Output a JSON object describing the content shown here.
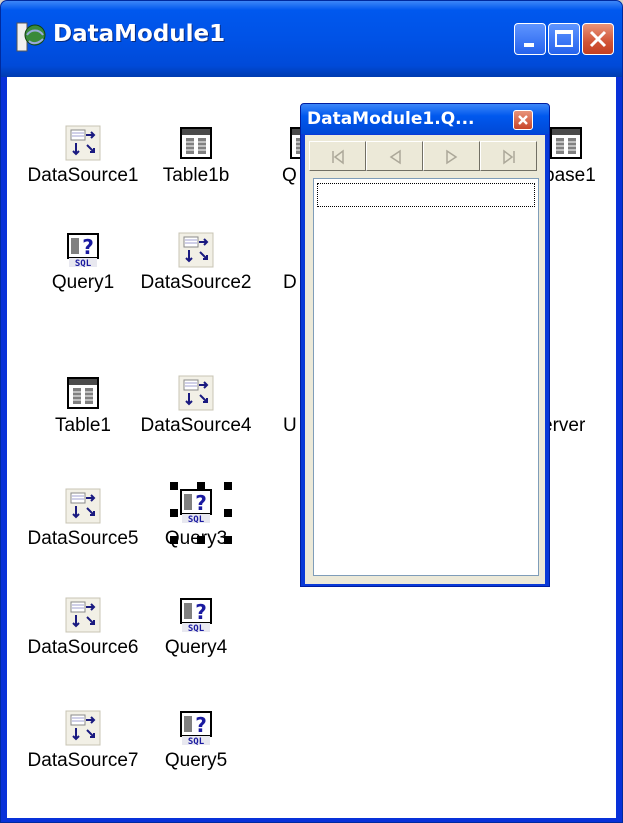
{
  "window": {
    "title": "DataModule1"
  },
  "components": [
    {
      "label": "DataSource1",
      "icon": "datasource-icon"
    },
    {
      "label": "Table1b",
      "icon": "table-icon"
    },
    {
      "label": "Q",
      "icon": "table-icon"
    },
    {
      "label": "base1",
      "icon": "database-icon"
    },
    {
      "label": "Query1",
      "icon": "query-sql-icon"
    },
    {
      "label": "DataSource2",
      "icon": "datasource-icon"
    },
    {
      "label": "D",
      "icon": "none"
    },
    {
      "label": "Table1",
      "icon": "table-icon"
    },
    {
      "label": "DataSource4",
      "icon": "datasource-icon"
    },
    {
      "label": "U",
      "icon": "none"
    },
    {
      "label": "erver",
      "icon": "none"
    },
    {
      "label": "DataSource5",
      "icon": "datasource-icon"
    },
    {
      "label": "Query3",
      "icon": "query-sql-icon",
      "selected": true
    },
    {
      "label": "DataSource6",
      "icon": "datasource-icon"
    },
    {
      "label": "Query4",
      "icon": "query-sql-icon"
    },
    {
      "label": "DataSource7",
      "icon": "datasource-icon"
    },
    {
      "label": "Query5",
      "icon": "query-sql-icon"
    }
  ],
  "floating_window": {
    "title": "DataModule1.Q...",
    "nav_buttons": [
      "first-record-icon",
      "prior-record-icon",
      "next-record-icon",
      "last-record-icon"
    ]
  },
  "colors": {
    "titlebar": "#0058ee",
    "close": "#d15436",
    "client_bg": "#ffffff"
  }
}
